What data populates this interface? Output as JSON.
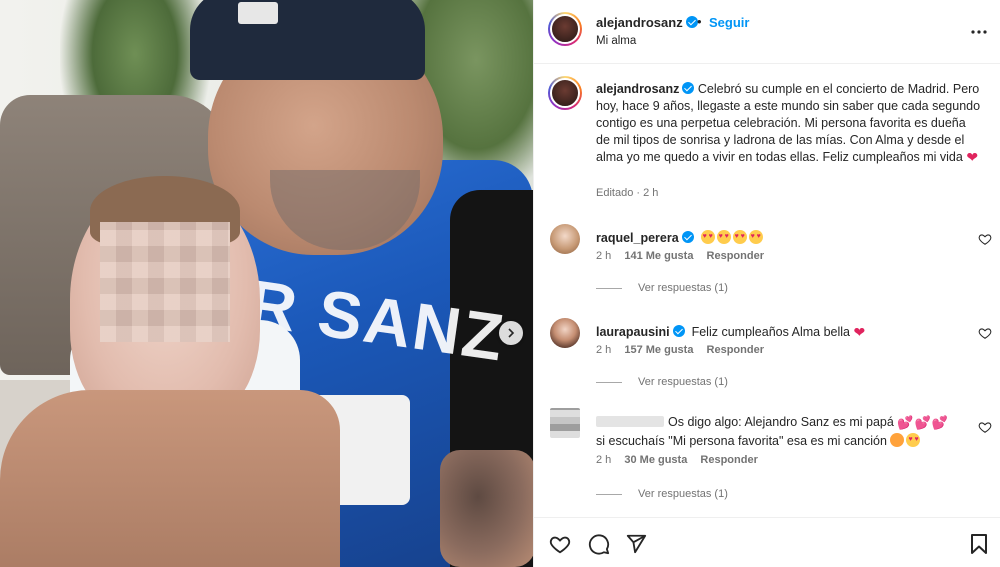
{
  "post": {
    "username": "alejandrosanz",
    "follow_label": "Seguir",
    "separator": "•",
    "location": "Mi alma",
    "caption_text": "Celebró su cumple en el concierto de Madrid. Pero hoy, hace 9 años, llegaste a este mundo sin saber que cada segundo contigo es una perpetua celebración. Mi persona favorita es dueña de mil tipos de sonrisa y ladrona de las mías. Con Alma y desde el alma yo me quedo a vivir en todas ellas. Feliz cumpleaños mi vida",
    "caption_emoji": "red-heart",
    "meta": "Editado · 2 h",
    "photo_alt": "alejandrosanz holding a baby",
    "jersey_text": "R SANZ"
  },
  "comments": [
    {
      "username": "raquel_perera",
      "verified": true,
      "text": "",
      "emojis": [
        "heart-eyes",
        "heart-eyes",
        "heart-eyes",
        "heart-eyes"
      ],
      "time": "2 h",
      "likes": "141 Me gusta",
      "reply_label": "Responder",
      "view_replies": "Ver respuestas (1)"
    },
    {
      "username": "laurapausini",
      "verified": true,
      "text": "Feliz cumpleaños Alma bella",
      "emojis": [
        "red-heart"
      ],
      "time": "2 h",
      "likes": "157 Me gusta",
      "reply_label": "Responder",
      "view_replies": "Ver respuestas (1)"
    },
    {
      "username": "",
      "verified": false,
      "text_line1": "Os digo algo: Alejandro Sanz es mi papá",
      "text_line2": "si escuchaís \"Mi persona favorita\" esa es mi canción",
      "emojis": [
        "sparkling-heart",
        "sparkling-heart",
        "sparkling-heart",
        "kiss",
        "heart-eyes"
      ],
      "time": "2 h",
      "likes": "30 Me gusta",
      "reply_label": "Responder",
      "view_replies": "Ver respuestas (1)"
    }
  ],
  "icons": {
    "more": "more-options-icon",
    "like": "heart-icon",
    "comment": "comment-icon",
    "share": "share-icon",
    "save": "bookmark-icon",
    "next": "chevron-right-icon"
  },
  "colors": {
    "accent": "#0095f6",
    "text": "#262626",
    "muted": "#737373",
    "heart_red": "#e0245e"
  }
}
